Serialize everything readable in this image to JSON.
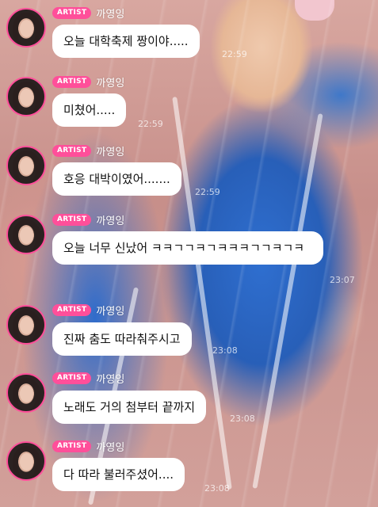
{
  "chat": {
    "badge_label": "ARTIST",
    "artist_name": "까영잉",
    "accent_color": "#ff4f9a",
    "messages": [
      {
        "text": "오늘 대학축제 짱이야.....",
        "time": "22:59"
      },
      {
        "text": "미쳤어.....",
        "time": "22:59"
      },
      {
        "text": "호응 대박이였어.......",
        "time": "22:59"
      },
      {
        "text": "오늘 너무 신났어 ㅋㅋㄱㄱㅋㄱㅋㅋㅋㄱㄱㅋㄱㅋ",
        "time": "23:07"
      },
      {
        "text": "진짜 춤도 따라춰주시고",
        "time": "23:08"
      },
      {
        "text": "노래도 거의 첨부터 끝까지",
        "time": "23:08"
      },
      {
        "text": "다 따라 불러주셨어....",
        "time": "23:08"
      }
    ]
  }
}
